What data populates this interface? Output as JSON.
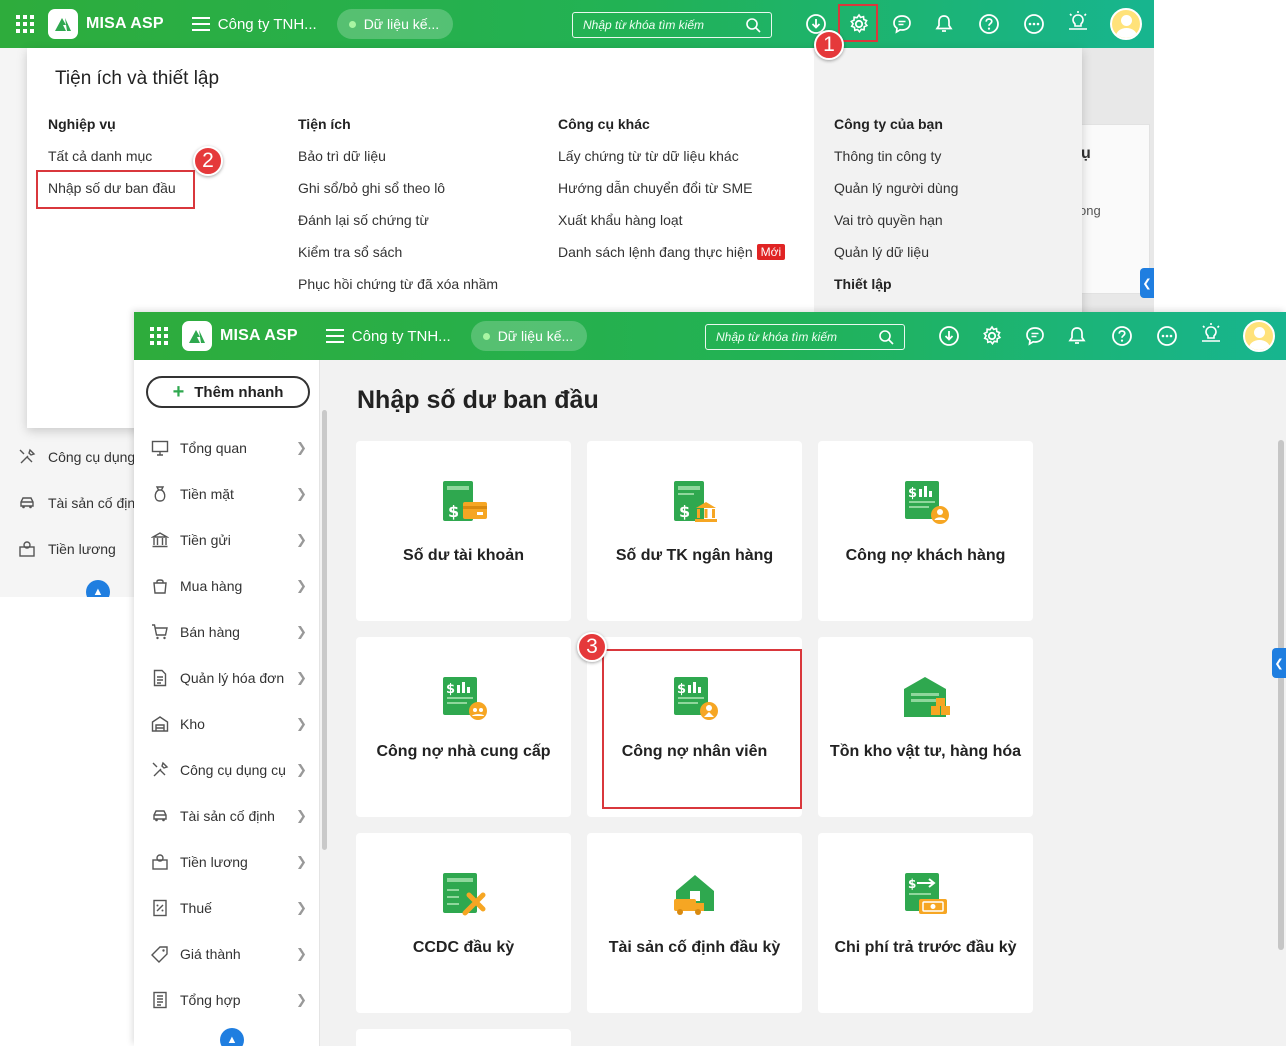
{
  "header": {
    "brand": "MISA ASP",
    "company": "Công ty TNH...",
    "data_pill": "Dữ liệu kế...",
    "search_placeholder": "Nhập từ khóa tìm kiếm"
  },
  "settings_panel": {
    "title": "Tiện ích và thiết lập",
    "columns": [
      {
        "heading": "Nghiệp vụ",
        "items": [
          "Tất cả danh mục",
          "Nhập số dư ban đầu"
        ]
      },
      {
        "heading": "Tiện ích",
        "items": [
          "Bảo trì dữ liệu",
          "Ghi sổ/bỏ ghi sổ theo lô",
          "Đánh lại số chứng từ",
          "Kiểm tra sổ sách",
          "Phục hồi chứng từ đã xóa nhầm"
        ]
      },
      {
        "heading": "Công cụ khác",
        "items": [
          "Lấy chứng từ từ dữ liệu khác",
          "Hướng dẫn chuyển đổi từ SME",
          "Xuất khẩu hàng loạt",
          "Danh sách lệnh đang thực hiện"
        ],
        "new_badge": "Mới"
      },
      {
        "heading": "Công ty của bạn",
        "items": [
          "Thông tin công ty",
          "Quản lý người dùng",
          "Vai trò quyền hạn",
          "Quản lý dữ liệu"
        ]
      },
      {
        "heading": "Thiết lập",
        "items": []
      }
    ]
  },
  "back_sidebar": {
    "items": [
      "Công cụ dụng",
      "Tài sản cố định",
      "Tiền lương"
    ]
  },
  "back_partial": {
    "card_text_a": "ụ",
    "card_text_b": "ong"
  },
  "steps": [
    "1",
    "2",
    "3"
  ],
  "sidebar": {
    "quick_add": "Thêm nhanh",
    "items": [
      {
        "label": "Tổng quan",
        "icon": "monitor-icon"
      },
      {
        "label": "Tiền mặt",
        "icon": "money-bag-icon"
      },
      {
        "label": "Tiền gửi",
        "icon": "bank-icon"
      },
      {
        "label": "Mua hàng",
        "icon": "shopping-bag-icon"
      },
      {
        "label": "Bán hàng",
        "icon": "cart-icon"
      },
      {
        "label": "Quản lý hóa đơn",
        "icon": "invoice-icon"
      },
      {
        "label": "Kho",
        "icon": "warehouse-icon"
      },
      {
        "label": "Công cụ dụng cụ",
        "icon": "tools-icon"
      },
      {
        "label": "Tài sản cố định",
        "icon": "car-icon"
      },
      {
        "label": "Tiền lương",
        "icon": "payroll-icon"
      },
      {
        "label": "Thuế",
        "icon": "tax-icon"
      },
      {
        "label": "Giá thành",
        "icon": "price-tag-icon"
      },
      {
        "label": "Tổng hợp",
        "icon": "summary-icon"
      }
    ]
  },
  "main": {
    "title": "Nhập số dư ban đầu",
    "cards": [
      {
        "label": "Số dư tài khoản",
        "icon": "account-balance-icon"
      },
      {
        "label": "Số dư TK ngân hàng",
        "icon": "bank-balance-icon"
      },
      {
        "label": "Công nợ khách hàng",
        "icon": "customer-debt-icon"
      },
      {
        "label": "Công nợ nhà cung cấp",
        "icon": "supplier-debt-icon"
      },
      {
        "label": "Công nợ nhân viên",
        "icon": "employee-debt-icon"
      },
      {
        "label": "Tồn kho vật tư, hàng hóa",
        "icon": "inventory-icon"
      },
      {
        "label": "CCDC đầu kỳ",
        "icon": "tools-opening-icon"
      },
      {
        "label": "Tài sản cố định đầu kỳ",
        "icon": "fixed-asset-icon"
      },
      {
        "label": "Chi phí trả trước đầu kỳ",
        "icon": "prepaid-expense-icon"
      }
    ]
  },
  "colors": {
    "header_start": "#2eac3c",
    "header_end": "#17b58f",
    "icon_green": "#2fa84f",
    "icon_orange": "#f6a623",
    "highlight_red": "#d9373c",
    "collapse_blue": "#1f7ee0"
  }
}
